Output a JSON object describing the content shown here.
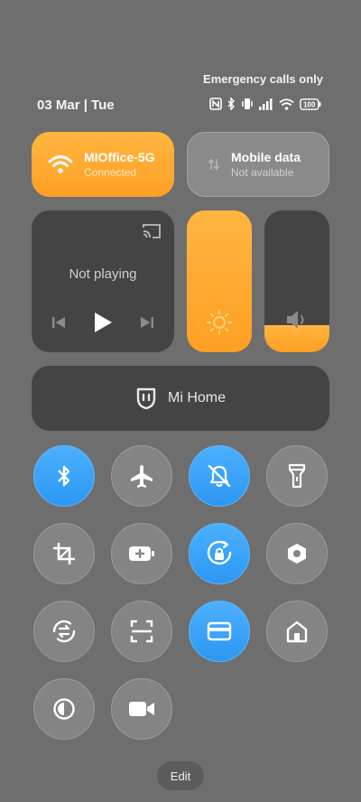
{
  "status": {
    "emergency_text": "Emergency calls only",
    "date": "03 Mar | Tue",
    "icons": [
      "nfc-icon",
      "bluetooth-icon",
      "vibrate-icon",
      "signal-icon",
      "wifi-icon",
      "battery-icon"
    ],
    "battery_level": "100"
  },
  "wifi_tile": {
    "title": "MIOffice-5G",
    "subtitle": "Connected",
    "active": true
  },
  "mobile_tile": {
    "title": "Mobile data",
    "subtitle": "Not available",
    "active": false
  },
  "media": {
    "status": "Not playing",
    "icons": [
      "cast-icon",
      "previous-icon",
      "play-icon",
      "next-icon"
    ]
  },
  "brightness": {
    "level_percent": 100,
    "icon": "brightness-icon"
  },
  "volume": {
    "level_percent": 19,
    "icon": "volume-icon"
  },
  "mi_home": {
    "label": "Mi Home",
    "icon": "mi-home-icon"
  },
  "toggles": [
    {
      "name": "bluetooth",
      "icon": "bluetooth-icon",
      "on": true
    },
    {
      "name": "airplane-mode",
      "icon": "airplane-icon",
      "on": false
    },
    {
      "name": "silent",
      "icon": "bell-off-icon",
      "on": true
    },
    {
      "name": "flashlight",
      "icon": "flashlight-icon",
      "on": false
    },
    {
      "name": "screenshot",
      "icon": "crop-icon",
      "on": false
    },
    {
      "name": "battery-saver",
      "icon": "battery-plus-icon",
      "on": false
    },
    {
      "name": "auto-rotate-lock",
      "icon": "rotate-lock-icon",
      "on": true
    },
    {
      "name": "settings",
      "icon": "hexagon-gear-icon",
      "on": false
    },
    {
      "name": "vpn",
      "icon": "sync-arrows-icon",
      "on": false
    },
    {
      "name": "scanner",
      "icon": "scan-icon",
      "on": false
    },
    {
      "name": "card",
      "icon": "card-icon",
      "on": true
    },
    {
      "name": "home",
      "icon": "home-icon",
      "on": false
    },
    {
      "name": "reading-mode",
      "icon": "contrast-icon",
      "on": false
    },
    {
      "name": "screen-recorder",
      "icon": "video-camera-icon",
      "on": false
    }
  ],
  "colors": {
    "background": "#6e6e6e",
    "accent_orange": "#ffa82e",
    "accent_blue": "#3aa3f8",
    "dark_tile": "#444444",
    "toggle_off": "#848484"
  },
  "edit_label": "Edit"
}
